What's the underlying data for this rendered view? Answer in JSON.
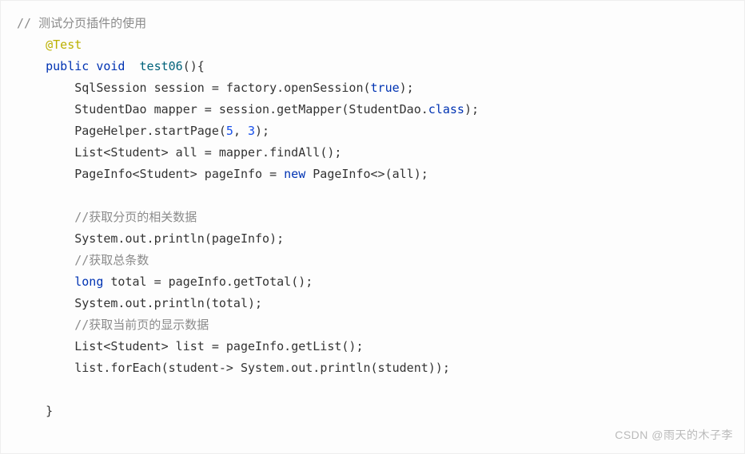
{
  "lines": {
    "l1_comment": "// 测试分页插件的使用",
    "l2_annotation": "@Test",
    "l3_kw1": "public",
    "l3_kw2": "void",
    "l3_method": "test06",
    "l3_paren": "(){",
    "l4_a": "SqlSession session = factory.",
    "l4_b": "openSession",
    "l4_c": "(",
    "l4_true": "true",
    "l4_d": ");",
    "l5_a": "StudentDao mapper = session.",
    "l5_b": "getMapper",
    "l5_c": "(StudentDao.",
    "l5_class": "class",
    "l5_d": ");",
    "l6_a": "PageHelper.",
    "l6_b": "startPage",
    "l6_c": "(",
    "l6_n1": "5",
    "l6_d": ", ",
    "l6_n2": "3",
    "l6_e": ");",
    "l7_a": "List<Student> all = mapper.",
    "l7_b": "findAll",
    "l7_c": "();",
    "l8_a": "PageInfo<Student> pageInfo = ",
    "l8_new": "new",
    "l8_b": " PageInfo<>(all);",
    "l10_comment": "//获取分页的相关数据",
    "l11_a": "System.out.",
    "l11_b": "println",
    "l11_c": "(pageInfo);",
    "l12_comment": "//获取总条数",
    "l13_kw": "long",
    "l13_a": " total = pageInfo.",
    "l13_b": "getTotal",
    "l13_c": "();",
    "l14_a": "System.out.",
    "l14_b": "println",
    "l14_c": "(total);",
    "l15_comment": "//获取当前页的显示数据",
    "l16_a": "List<Student> list = pageInfo.",
    "l16_b": "getList",
    "l16_c": "();",
    "l17_a": "list.",
    "l17_b": "forEach",
    "l17_c": "(student-> System.out.",
    "l17_d": "println",
    "l17_e": "(student));",
    "l19_close": "}"
  },
  "watermark": "CSDN @雨天的木子李"
}
